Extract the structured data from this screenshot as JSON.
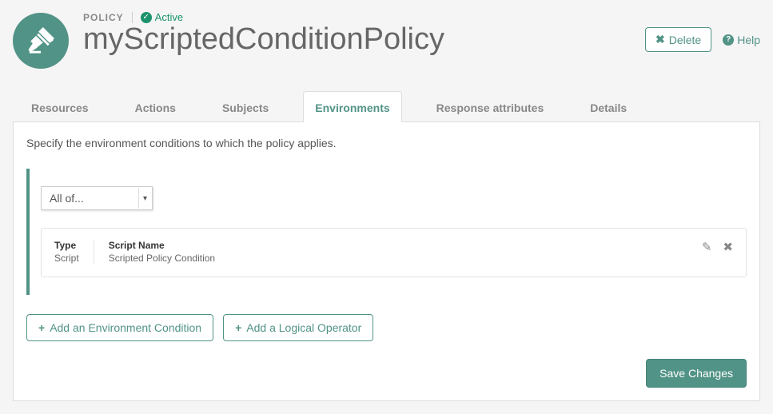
{
  "header": {
    "type_label": "POLICY",
    "status_label": "Active",
    "title": "myScriptedConditionPolicy",
    "delete_label": "Delete",
    "help_label": "Help"
  },
  "tabs": [
    {
      "label": "Resources"
    },
    {
      "label": "Actions"
    },
    {
      "label": "Subjects"
    },
    {
      "label": "Environments"
    },
    {
      "label": "Response attributes"
    },
    {
      "label": "Details"
    }
  ],
  "active_tab_index": 3,
  "panel": {
    "description": "Specify the environment conditions to which the policy applies.",
    "combobox_value": "All of...",
    "script_card": {
      "type_label": "Type",
      "type_value": "Script",
      "name_label": "Script Name",
      "name_value": "Scripted Policy Condition"
    },
    "add_env_label": "Add an Environment Condition",
    "add_logical_label": "Add a Logical Operator",
    "save_label": "Save Changes"
  }
}
